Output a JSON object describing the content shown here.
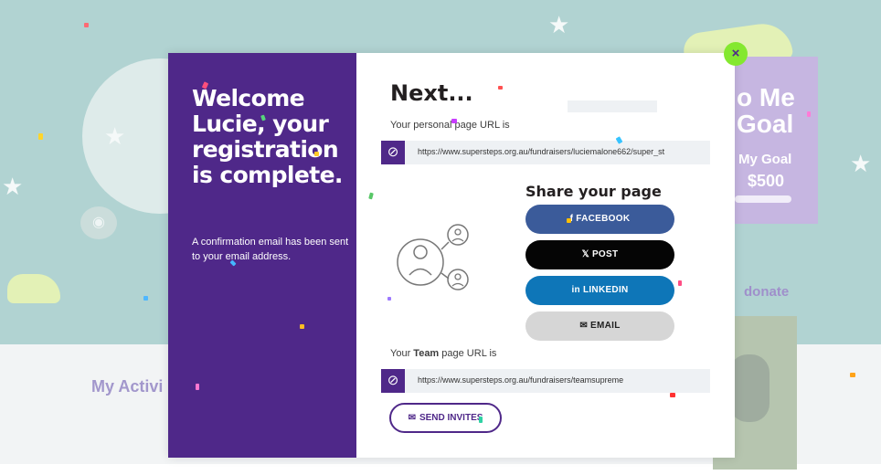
{
  "background": {
    "goal_title": "o Me\nGoal",
    "goal_label": "My Goal",
    "goal_amount": "$500",
    "donate_text": "donate",
    "activity_heading": "My Activi"
  },
  "modal": {
    "close_symbol": "×",
    "welcome_heading": "Welcome Lucie, your registration is complete.",
    "confirmation_text": "A confirmation email has been sent to your email address.",
    "next_heading": "Next...",
    "personal_url_label": "Your personal page URL is",
    "personal_url": "https://www.supersteps.org.au/fundraisers/luciemalone662/super_st",
    "share_title": "Share your page",
    "share_buttons": [
      {
        "label": "FACEBOOK",
        "icon_text": "f",
        "icon": "facebook-icon"
      },
      {
        "label": "POST",
        "icon_text": "𝕏",
        "icon": "x-icon"
      },
      {
        "label": "LINKEDIN",
        "icon_text": "in",
        "icon": "linkedin-icon"
      },
      {
        "label": "EMAIL",
        "icon_text": "✉",
        "icon": "email-icon"
      }
    ],
    "team_url_label_prefix": "Your ",
    "team_url_label_bold": "Team",
    "team_url_label_suffix": " page URL is",
    "team_url": "https://www.supersteps.org.au/fundraisers/teamsupreme",
    "send_invites_label": "SEND INVITES",
    "send_invites_icon": "✉",
    "link_icon": "⊘"
  },
  "colors": {
    "purple": "#4f2889",
    "facebook": "#3b5b9a",
    "x": "#050505",
    "linkedin": "#0e76b8",
    "email": "#d6d6d6",
    "close": "#84e82f"
  }
}
